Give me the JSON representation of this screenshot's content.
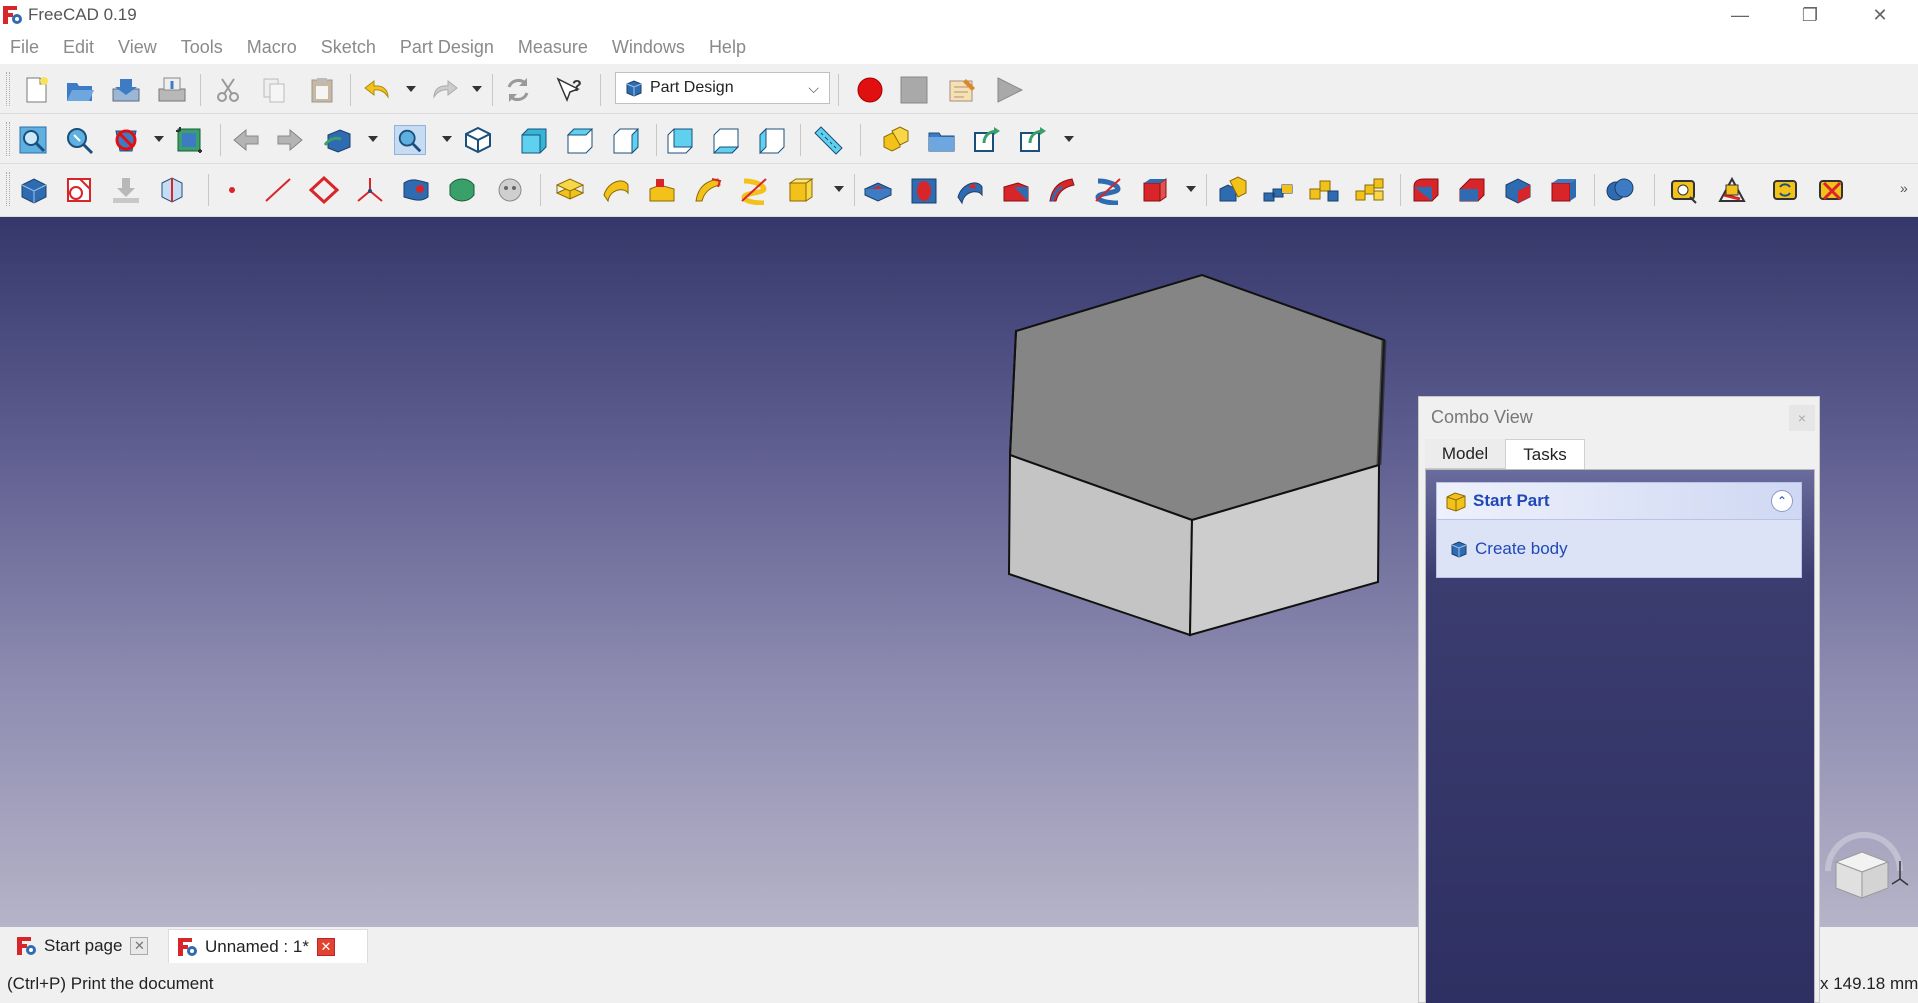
{
  "window": {
    "title": "FreeCAD 0.19",
    "controls": {
      "minimize": "—",
      "restore": "❐",
      "close": "✕"
    }
  },
  "menu": [
    "File",
    "Edit",
    "View",
    "Tools",
    "Macro",
    "Sketch",
    "Part Design",
    "Measure",
    "Windows",
    "Help"
  ],
  "toolbar": {
    "workbench": "Part Design",
    "file_icons": [
      "new-document-icon",
      "open-icon",
      "save-icon",
      "save-as-icon",
      "cut-icon",
      "copy-icon",
      "paste-icon",
      "undo-icon",
      "redo-icon",
      "refresh-icon",
      "whats-this-icon"
    ],
    "macro_icons": [
      "record-macro-icon",
      "stop-macro-icon",
      "macro-editor-icon",
      "execute-macro-icon"
    ],
    "view_icons": [
      "fit-all-icon",
      "fit-selection-icon",
      "draw-style-icon",
      "bounding-box-icon",
      "back-icon",
      "forward-icon",
      "std-views-icon",
      "isometric-icon",
      "front-view-icon",
      "top-view-icon",
      "right-view-icon",
      "rear-view-icon",
      "bottom-view-icon",
      "left-view-icon",
      "measure-distance-icon",
      "part-icon",
      "group-icon",
      "link-icon",
      "link-actions-icon"
    ],
    "part_design_icons": [
      "create-body-icon",
      "create-sketch-icon",
      "validate-sketch-icon",
      "shape-binder-icon",
      "datum-point-icon",
      "datum-line-icon",
      "datum-plane-icon",
      "local-cs-icon",
      "clone-icon",
      "sub-shape-binder-icon",
      "pad-icon",
      "revolution-icon",
      "additive-loft-icon",
      "additive-pipe-icon",
      "additive-helix-icon",
      "additive-primitive-icon",
      "pocket-icon",
      "hole-icon",
      "groove-icon",
      "subtractive-loft-icon",
      "subtractive-pipe-icon",
      "subtractive-helix-icon",
      "subtractive-primitive-icon",
      "mirrored-icon",
      "linear-pattern-icon",
      "polar-pattern-icon",
      "multi-transform-icon",
      "fillet-icon",
      "chamfer-icon",
      "draft-icon",
      "thickness-icon",
      "boolean-icon",
      "measure-linear-icon",
      "measure-angular-icon",
      "measure-refresh-icon",
      "measure-clear-icon"
    ]
  },
  "colors": {
    "record": "#e01010",
    "pad_yellow": "#f2c21b",
    "subtract_red": "#d8252a",
    "part_blue": "#2f6bb0",
    "task_link": "#2148b5"
  },
  "combo_view": {
    "title": "Combo View",
    "close": "×",
    "tabs": [
      "Model",
      "Tasks"
    ],
    "active_tab": "Tasks",
    "task_box": {
      "title": "Start Part",
      "collapse": "⌃",
      "action": "Create body"
    }
  },
  "doc_tabs": [
    {
      "label": "Start page",
      "close": "✕"
    },
    {
      "label": "Unnamed : 1*",
      "close": "✕",
      "active": true
    }
  ],
  "status": {
    "message": "(Ctrl+P) Print the document",
    "dimensions": "x 149.18 mm"
  }
}
